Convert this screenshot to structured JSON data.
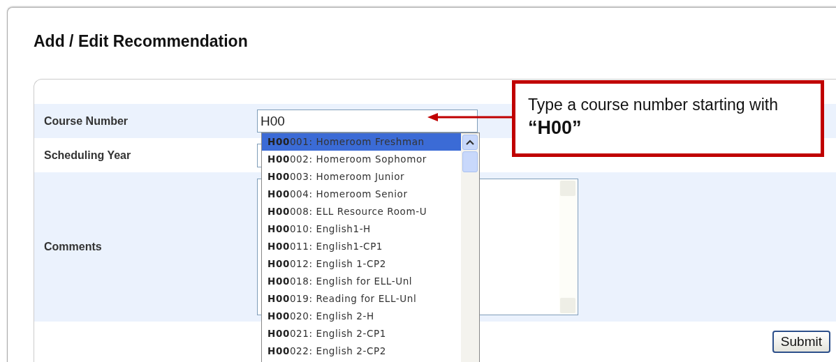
{
  "title": "Add / Edit Recommendation",
  "form": {
    "course_number": {
      "label": "Course Number",
      "value": "H00"
    },
    "scheduling_year": {
      "label": "Scheduling Year"
    },
    "comments": {
      "label": "Comments"
    },
    "submit": "Submit"
  },
  "suggestions": [
    {
      "text": "**H00**001: Homeroom Freshman",
      "selected": true
    },
    {
      "text": "**H00**002: Homeroom Sophomor",
      "selected": false
    },
    {
      "text": "**H00**003: Homeroom Junior",
      "selected": false
    },
    {
      "text": "**H00**004: Homeroom Senior",
      "selected": false
    },
    {
      "text": "**H00**008: ELL Resource Room-U",
      "selected": false
    },
    {
      "text": "**H00**010: English1-H",
      "selected": false
    },
    {
      "text": "**H00**011: English1-CP1",
      "selected": false
    },
    {
      "text": "**H00**012: English 1-CP2",
      "selected": false
    },
    {
      "text": "**H00**018: English for ELL-Unl",
      "selected": false
    },
    {
      "text": "**H00**019: Reading for ELL-Unl",
      "selected": false
    },
    {
      "text": "**H00**020: English 2-H",
      "selected": false
    },
    {
      "text": "**H00**021: English 2-CP1",
      "selected": false
    },
    {
      "text": "**H00**022: English 2-CP2",
      "selected": false
    }
  ],
  "callout": "Type a course number starting with **“H00”**"
}
